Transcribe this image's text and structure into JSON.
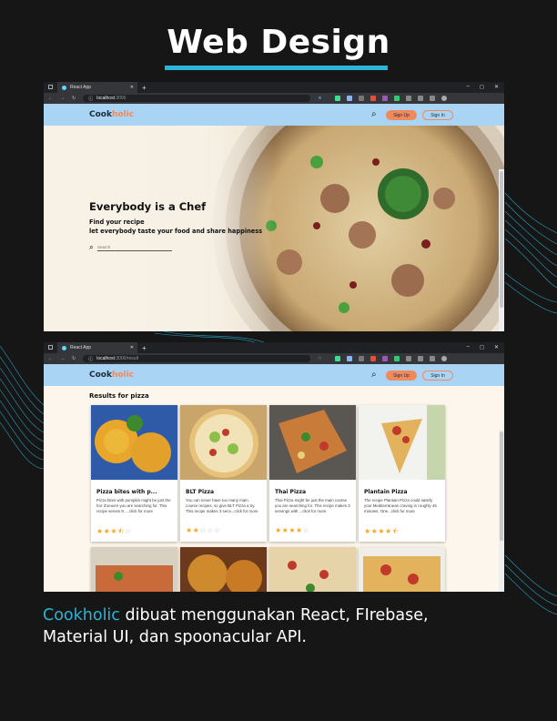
{
  "heading": "Web Design",
  "colors": {
    "accent": "#2bb3d8",
    "brand_orange": "#f08a5d",
    "appbar": "#a9d4f3",
    "star": "#f5a623"
  },
  "browser1": {
    "tab_title": "React App",
    "url_host": "localhost",
    "url_rest": ":3000"
  },
  "browser2": {
    "tab_title": "React App",
    "url_host": "localhost",
    "url_rest": ":3000/result"
  },
  "app": {
    "logo_a": "Cook",
    "logo_b": "holic",
    "signup_label": "Sign Up",
    "signin_label": "Sign In"
  },
  "hero": {
    "title": "Everybody is a Chef",
    "line1": "Find your recipe",
    "line2": "let everybody taste your food and share happiness",
    "search_placeholder": "Search"
  },
  "results": {
    "title": "Results for pizza",
    "cards": [
      {
        "title": "Pizza bites with p...",
        "desc": "Pizza bites with pumpkin might be just the hor d'oeuvre you are searching for. This recipe serves 8. ...click for more",
        "rating": 3.5
      },
      {
        "title": "BLT Pizza",
        "desc": "You can never have too many main course recipes, so give BLT Pizza a try. This recipe makes 3 servi...click for more",
        "rating": 2
      },
      {
        "title": "Thai Pizza",
        "desc": "Thai Pizza might be just the main course you are searching for. This recipe makes 3 servings with ...click for more",
        "rating": 4
      },
      {
        "title": "Plantain Pizza",
        "desc": "The recipe Plantain Pizza could satisfy your Mediterranean craving in roughly 45 minutes. One...click for more",
        "rating": 4.5
      }
    ]
  },
  "caption": {
    "brand": "Cookholic",
    "rest_line1": " dibuat menggunakan React, FIrebase,",
    "line2": "Material UI, dan spoonacular API."
  }
}
